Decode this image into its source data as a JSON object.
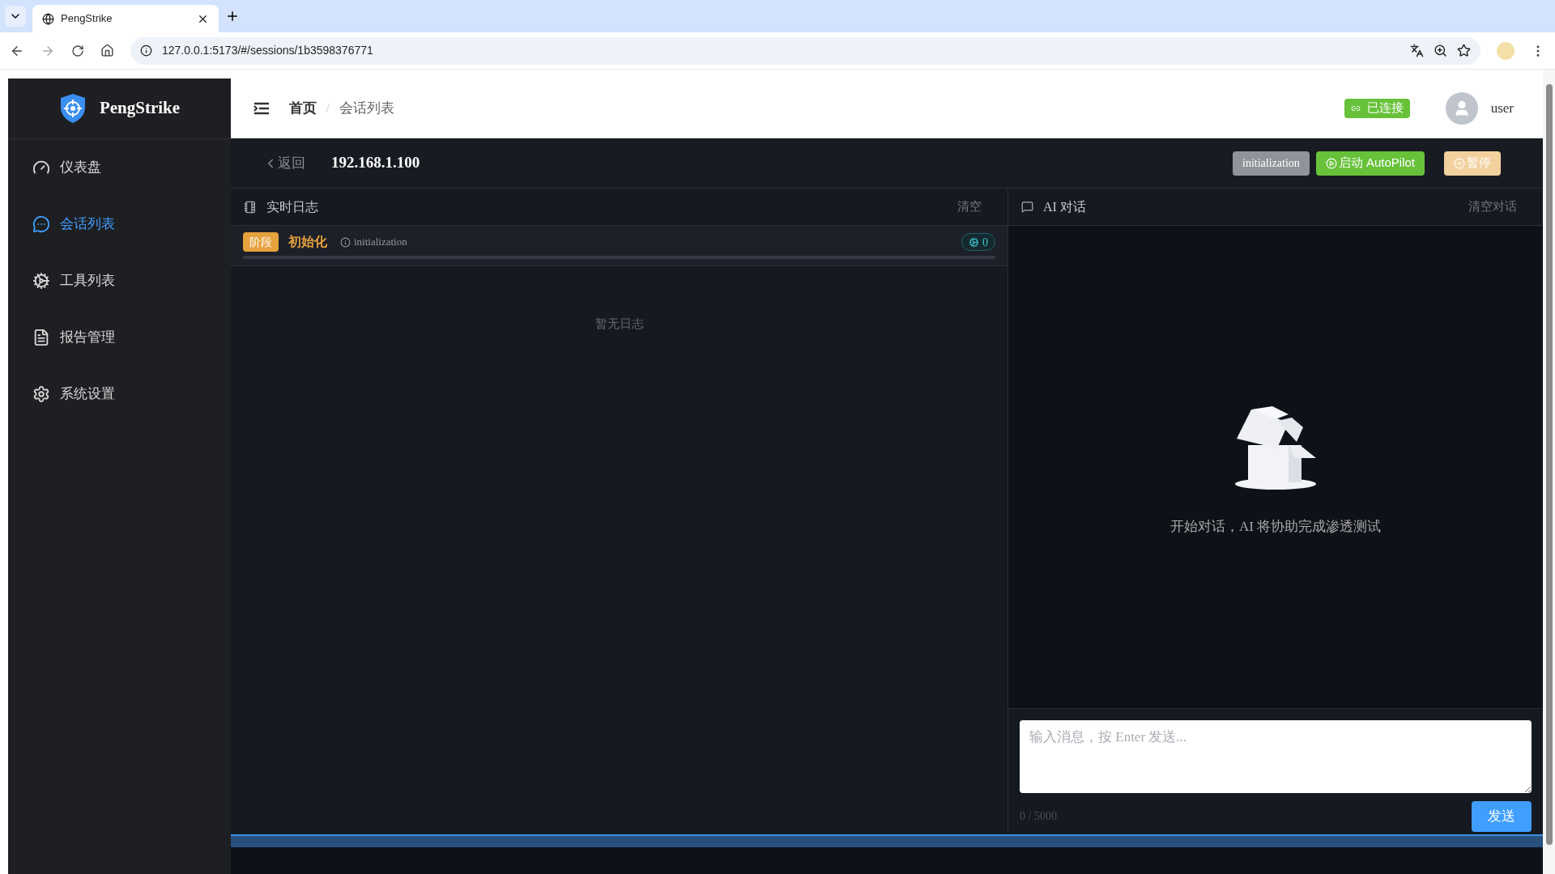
{
  "browser": {
    "tab_title": "PengStrike",
    "url": "127.0.0.1:5173/#/sessions/1b3598376771"
  },
  "sidebar": {
    "brand": "PengStrike",
    "items": [
      {
        "label": "仪表盘",
        "selected": false
      },
      {
        "label": "会话列表",
        "selected": true
      },
      {
        "label": "工具列表",
        "selected": false
      },
      {
        "label": "报告管理",
        "selected": false
      },
      {
        "label": "系统设置",
        "selected": false
      }
    ]
  },
  "header": {
    "breadcrumb": [
      "首页",
      "会话列表"
    ],
    "separator": "/",
    "connection": "已连接",
    "user": "user"
  },
  "session": {
    "back": "返回",
    "target": "192.168.1.100",
    "phase": "initialization",
    "autopilot": "启动 AutoPilot",
    "pause": {
      "label": "暂停",
      "disabled": true
    }
  },
  "log_panel": {
    "title": "实时日志",
    "clear": "清空",
    "stage_tag": "阶段",
    "stage_name": "初始化",
    "stage_hint": "initialization",
    "tool_count": "0",
    "empty": "暂无日志"
  },
  "chat_panel": {
    "title": "AI 对话",
    "clear": "清空对话",
    "empty": "开始对话，AI 将协助完成渗透测试",
    "placeholder": "输入消息，按 Enter 发送...",
    "counter": "0 / 5000",
    "send": "发送"
  }
}
